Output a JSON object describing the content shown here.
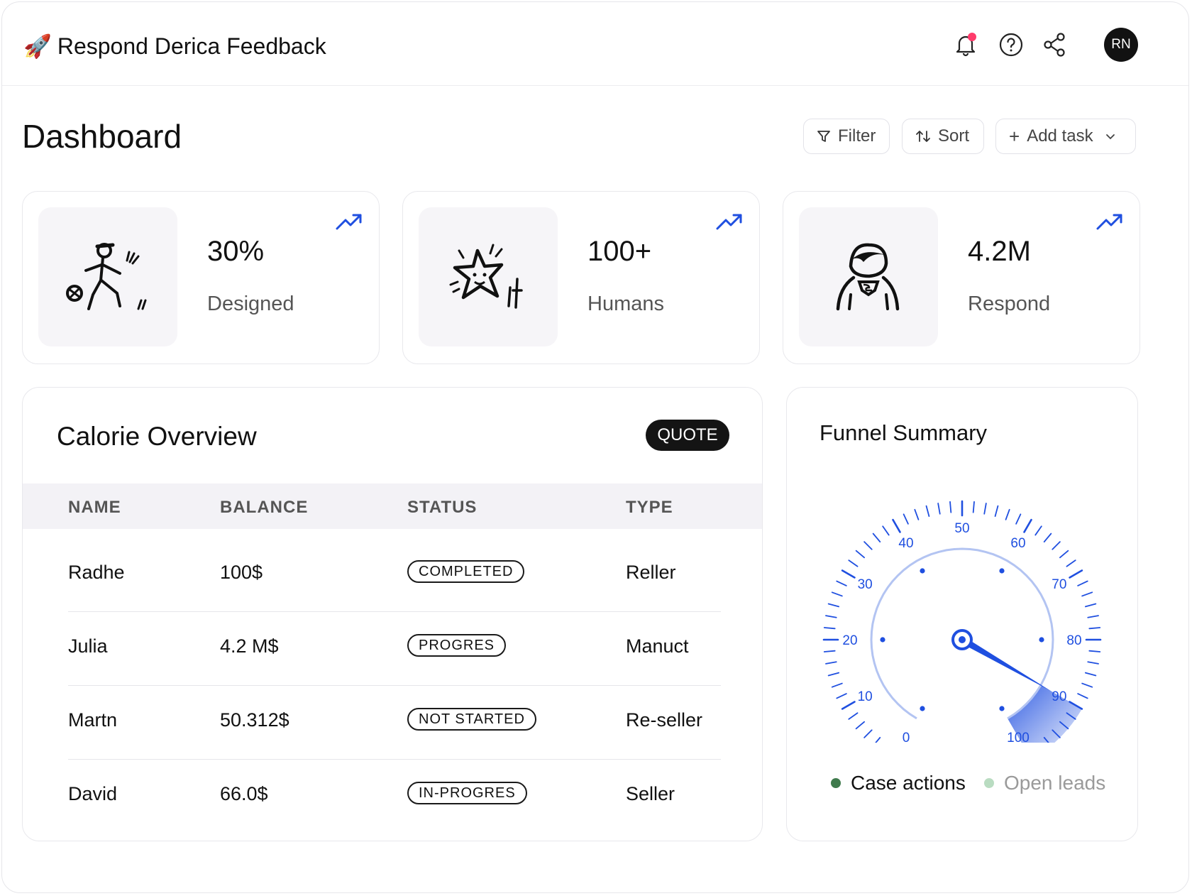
{
  "header": {
    "app_title": "Respond Derica Feedback",
    "icons": [
      "bell-icon",
      "help-icon",
      "share-icon"
    ],
    "notification_dot_color": "#ff3b6b",
    "avatar_initials": "RN"
  },
  "page": {
    "title": "Dashboard",
    "toolbar": {
      "filter_label": "Filter",
      "sort_label": "Sort",
      "add_task_label": "Add task"
    }
  },
  "stats": [
    {
      "value": "30%",
      "label": "Designed",
      "illustration": "kicking-ball-person"
    },
    {
      "value": "100+",
      "label": "Humans",
      "illustration": "happy-star"
    },
    {
      "value": "4.2M",
      "label": "Respond",
      "illustration": "superhero"
    }
  ],
  "calorie": {
    "title": "Calorie Overview",
    "badge": "QUOTE",
    "columns": [
      "NAME",
      "BALANCE",
      "STATUS",
      "TYPE"
    ],
    "rows": [
      {
        "name": "Radhe",
        "balance": "100$",
        "status": "COMPLETED",
        "type": "Reller"
      },
      {
        "name": "Julia",
        "balance": "4.2 M$",
        "status": "PROGRES",
        "type": "Manuct"
      },
      {
        "name": "Martn",
        "balance": "50.312$",
        "status": "NOT STARTED",
        "type": "Re-seller"
      },
      {
        "name": "David",
        "balance": "66.0$",
        "status": "IN-PROGRES",
        "type": "Seller"
      }
    ]
  },
  "funnel": {
    "title": "Funnel Summary",
    "gauge": {
      "min": 0,
      "max": 100,
      "value": 90,
      "tick_labels": [
        "0",
        "10",
        "20",
        "30",
        "40",
        "50",
        "60",
        "70",
        "80",
        "90",
        "100"
      ],
      "accent_color": "#1f4fe0"
    },
    "legend": [
      {
        "label": "Case actions",
        "color": "#3f7a4c"
      },
      {
        "label": "Open leads",
        "color": "#b9dcc1"
      }
    ]
  }
}
